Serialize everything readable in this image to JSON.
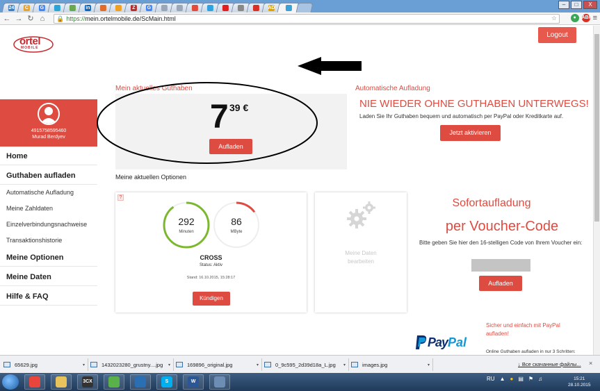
{
  "browser": {
    "tabs": [
      {
        "badge": "24",
        "color": "#3b7fc4"
      },
      {
        "badge": "C",
        "color": "#e5a32f"
      },
      {
        "badge": "G",
        "color": "#4285f4"
      },
      {
        "badge": "",
        "color": "#2aa4d5"
      },
      {
        "badge": "",
        "color": "#6aa84f"
      },
      {
        "badge": "in",
        "color": "#0a66c2"
      },
      {
        "badge": "",
        "color": "#e06b2b"
      },
      {
        "badge": "",
        "color": "#f0a020"
      },
      {
        "badge": "Z",
        "color": "#b82c2c"
      },
      {
        "badge": "G",
        "color": "#4285f4"
      },
      {
        "badge": "",
        "color": "#9aa7b8"
      },
      {
        "badge": "",
        "color": "#9aa7b8"
      },
      {
        "badge": "",
        "color": "#e24a3b"
      },
      {
        "badge": "",
        "color": "#2fa3e0"
      },
      {
        "badge": "",
        "color": "#e02020"
      },
      {
        "badge": "",
        "color": "#888"
      },
      {
        "badge": "",
        "color": "#d93025"
      },
      {
        "badge": "AD",
        "color": "#e0a000"
      },
      {
        "badge": "",
        "color": "#3aa0d8"
      }
    ],
    "url_scheme": "https://",
    "url_rest": "mein.ortelmobile.de/ScMain.html",
    "window_controls": [
      "–",
      "□",
      "X"
    ]
  },
  "header": {
    "logo_text": "ortel",
    "logo_sub": "MOBILE",
    "logout_label": "Logout"
  },
  "profile": {
    "number": "4915758595460",
    "name": "Murad Berdyev"
  },
  "sidebar": {
    "items": [
      {
        "label": "Home",
        "type": "main"
      },
      {
        "label": "Guthaben aufladen",
        "type": "main"
      },
      {
        "label": "Automatische Aufladung",
        "type": "sub"
      },
      {
        "label": "Meine Zahldaten",
        "type": "sub"
      },
      {
        "label": "Einzelverbindungsnachweise",
        "type": "sub"
      },
      {
        "label": "Transaktionshistorie",
        "type": "sub"
      },
      {
        "label": "Meine Optionen",
        "type": "main"
      },
      {
        "label": "Meine Daten",
        "type": "main"
      },
      {
        "label": "Hilfe & FAQ",
        "type": "main"
      }
    ]
  },
  "guthaben": {
    "title": "Mein aktuelles Guthaben",
    "euros": "7",
    "cents": "39 €",
    "button": "Aufladen"
  },
  "auto": {
    "title": "Automatische Aufladung",
    "headline": "NIE WIEDER OHNE GUTHABEN UNTERWEGS!",
    "text": "Laden Sie Ihr Guthaben bequem und automatisch per PayPal oder Kreditkarte auf.",
    "button": "Jetzt aktivieren"
  },
  "optionen": {
    "title": "Meine aktuellen Optionen",
    "help": "?",
    "minutes": {
      "value": "292",
      "unit": "Minuten",
      "remaining_fraction": 0.9,
      "color": "#7cb82f"
    },
    "data": {
      "value": "86",
      "unit": "MByte",
      "remaining_fraction": 0.15,
      "color": "#dd4b41"
    },
    "name": "CROSS",
    "status": "Status: Aktiv",
    "stand": "Stand: 16.10.2015, 15:28:17",
    "button": "Kündigen"
  },
  "daten_card": {
    "line1": "Meine Daten",
    "line2": "bearbeiten"
  },
  "voucher": {
    "heading1": "Sofortaufladung",
    "heading2": "per Voucher-Code",
    "text": "Bitte geben Sie hier den 16-stelligen Code von Ihrem Voucher ein:",
    "input_value": "",
    "button": "Aufladen"
  },
  "paypal": {
    "logo_pay": "Pay",
    "logo_pal": "Pal",
    "text1": "Sicher und einfach mit PayPal aufladen!",
    "text2": "Online Guthaben aufladen in nur 3 Schritten:"
  },
  "downloads": {
    "items": [
      "65629.jpg",
      "1432023280_grustny....jpg",
      "169896_original.jpg",
      "0_9c595_2d39d18a_L.jpg",
      "images.jpg"
    ],
    "show_all": "↓ Все скачанные файлы...",
    "close": "×"
  },
  "taskbar": {
    "apps": [
      {
        "label": "",
        "color": "#e8453c"
      },
      {
        "label": "",
        "color": "#e8c25a"
      },
      {
        "label": "3CX",
        "color": "#333"
      },
      {
        "label": "",
        "color": "#5ab14a"
      },
      {
        "label": "",
        "color": "#2a6fb3"
      },
      {
        "label": "S",
        "color": "#00aff0"
      },
      {
        "label": "W",
        "color": "#2b5797"
      },
      {
        "label": "",
        "color": "#6d8db5"
      }
    ],
    "lang": "RU",
    "time": "15:21",
    "date": "28.10.2015"
  }
}
